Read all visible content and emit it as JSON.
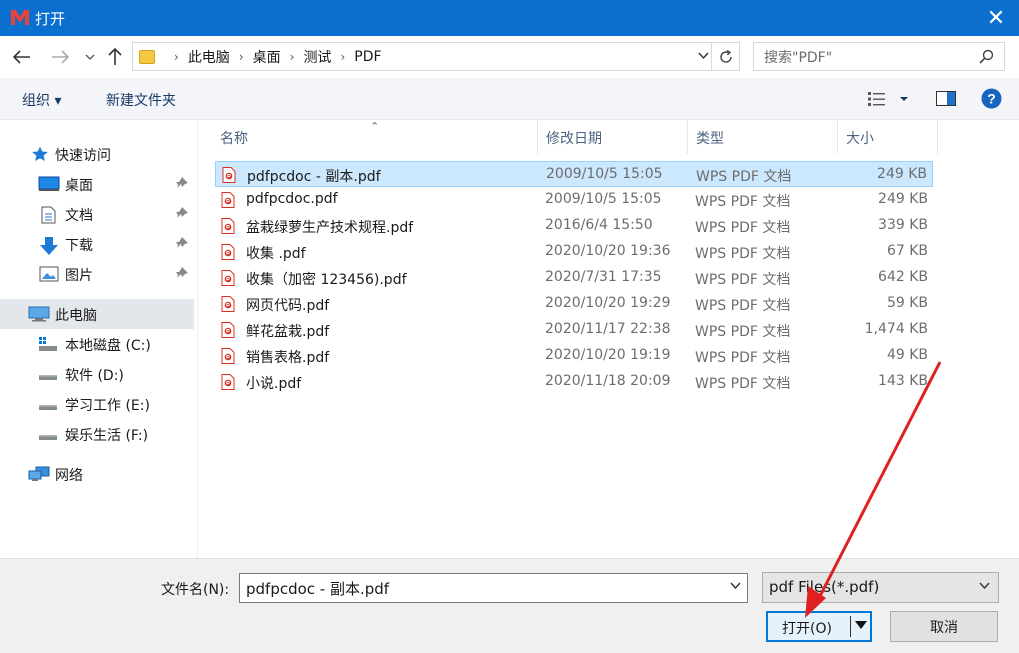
{
  "window": {
    "title": "打开",
    "close": "✕"
  },
  "address": {
    "crumbs": [
      "此电脑",
      "桌面",
      "测试",
      "PDF"
    ],
    "search_placeholder": "搜索\"PDF\""
  },
  "toolbar": {
    "organize": "组织 ▾",
    "new_folder": "新建文件夹"
  },
  "sidebar": {
    "quick_access": "快速访问",
    "items": [
      {
        "label": "桌面"
      },
      {
        "label": "文档"
      },
      {
        "label": "下载"
      },
      {
        "label": "图片"
      }
    ],
    "this_pc": "此电脑",
    "drives": [
      {
        "label": "本地磁盘 (C:)"
      },
      {
        "label": "软件 (D:)"
      },
      {
        "label": "学习工作 (E:)"
      },
      {
        "label": "娱乐生活 (F:)"
      }
    ],
    "network": "网络"
  },
  "columns": {
    "name": "名称",
    "date": "修改日期",
    "type": "类型",
    "size": "大小"
  },
  "files": [
    {
      "name": "pdfpcdoc - 副本.pdf",
      "date": "2009/10/5 15:05",
      "type": "WPS PDF 文档",
      "size": "249 KB",
      "selected": true
    },
    {
      "name": "pdfpcdoc.pdf",
      "date": "2009/10/5 15:05",
      "type": "WPS PDF 文档",
      "size": "249 KB"
    },
    {
      "name": "盆栽绿萝生产技术规程.pdf",
      "date": "2016/6/4 15:50",
      "type": "WPS PDF 文档",
      "size": "339 KB"
    },
    {
      "name": "收集 .pdf",
      "date": "2020/10/20 19:36",
      "type": "WPS PDF 文档",
      "size": "67 KB"
    },
    {
      "name": "收集（加密 123456).pdf",
      "date": "2020/7/31 17:35",
      "type": "WPS PDF 文档",
      "size": "642 KB"
    },
    {
      "name": "网页代码.pdf",
      "date": "2020/10/20 19:29",
      "type": "WPS PDF 文档",
      "size": "59 KB"
    },
    {
      "name": "鲜花盆栽.pdf",
      "date": "2020/11/17 22:38",
      "type": "WPS PDF 文档",
      "size": "1,474 KB"
    },
    {
      "name": "销售表格.pdf",
      "date": "2020/10/20 19:19",
      "type": "WPS PDF 文档",
      "size": "49 KB"
    },
    {
      "name": "小说.pdf",
      "date": "2020/11/18 20:09",
      "type": "WPS PDF 文档",
      "size": "143 KB"
    }
  ],
  "bottom": {
    "filename_label": "文件名(N):",
    "filename_value": "pdfpcdoc - 副本.pdf",
    "filetype": "pdf Files(*.pdf)",
    "open_button": "打开(O)",
    "cancel_button": "取消"
  },
  "colors": {
    "titlebar": "#0a6fcf",
    "accent": "#0078d7",
    "annotation": "#e02020",
    "pdf_icon": "#d93025"
  }
}
